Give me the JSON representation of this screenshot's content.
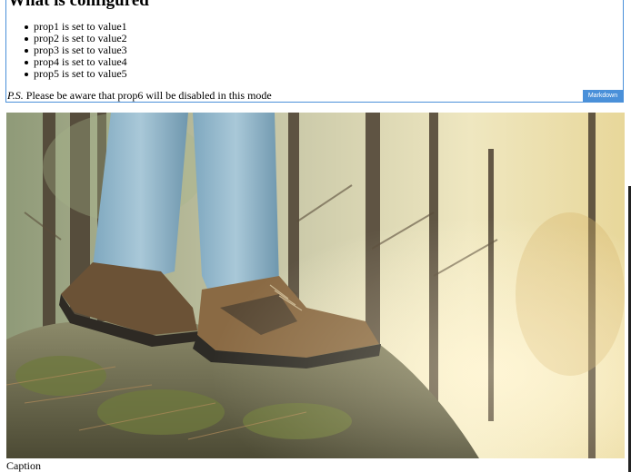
{
  "markdown_block": {
    "title": "What is configured",
    "items": [
      "prop1 is set to value1",
      "prop2 is set to value2",
      "prop3 is set to value3",
      "prop4 is set to value4",
      "prop5 is set to value5"
    ],
    "note_prefix": "P.S.",
    "note_text": " Please be aware that prop6 will be disabled in this mode",
    "badge_label": "Markdown",
    "accent_color": "#4a90d9"
  },
  "image": {
    "icon": "photo-hiking-boots"
  },
  "caption": "Caption"
}
